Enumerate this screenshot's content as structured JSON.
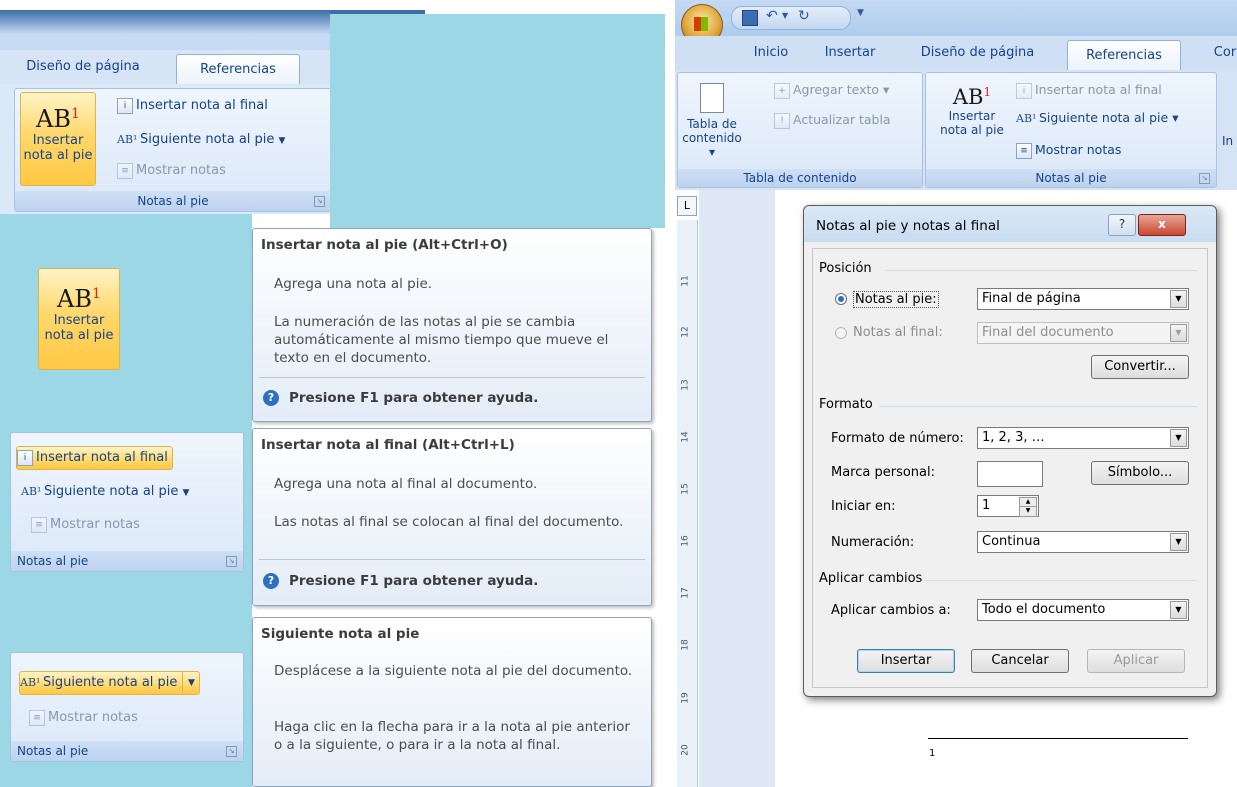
{
  "left": {
    "tabs": [
      "Diseño de página",
      "Referencias"
    ],
    "top_group": {
      "big_button": {
        "line1": "Insertar",
        "line2": "nota al pie"
      },
      "insert_endnote": "Insertar nota al final",
      "next_footnote": "Siguiente nota al pie",
      "show_notes": "Mostrar notas",
      "group_label": "Notas al pie"
    },
    "tooltip1": {
      "title": "Insertar nota al pie (Alt+Ctrl+O)",
      "p1": "Agrega una nota al pie.",
      "p2": "La numeración de las notas al pie se cambia automáticamente al mismo tiempo que mueve el texto en el documento.",
      "help": "Presione F1 para obtener ayuda."
    },
    "big_button2": {
      "line1": "Insertar",
      "line2": "nota al pie"
    },
    "mid_group": {
      "insert_endnote": "Insertar nota al final",
      "next_footnote": "Siguiente nota al pie",
      "show_notes": "Mostrar notas",
      "group_label": "Notas al pie"
    },
    "tooltip2": {
      "title": "Insertar nota al final (Alt+Ctrl+L)",
      "p1": "Agrega una nota al final al documento.",
      "p2": "Las notas al final se colocan al final del documento.",
      "help": "Presione F1 para obtener ayuda."
    },
    "bottom_group": {
      "next_footnote": "Siguiente nota al pie",
      "show_notes": "Mostrar notas",
      "group_label": "Notas al pie"
    },
    "tooltip3": {
      "title": "Siguiente nota al pie",
      "p1": "Desplácese a la siguiente nota al pie del documento.",
      "p2": "Haga clic en la flecha para ir a la nota al pie anterior o a la siguiente, o para ir a la nota al final."
    }
  },
  "right": {
    "tabs": [
      "Inicio",
      "Insertar",
      "Diseño de página",
      "Referencias",
      "Cor"
    ],
    "toc_group": {
      "toc_button_line1": "Tabla de",
      "toc_button_line2": "contenido",
      "add_text": "Agregar texto",
      "update_table": "Actualizar tabla",
      "group_label": "Tabla de contenido"
    },
    "notes_group": {
      "insert_line1": "Insertar",
      "insert_line2": "nota al pie",
      "insert_endnote": "Insertar nota al final",
      "next_footnote": "Siguiente nota al pie",
      "show_notes": "Mostrar notas",
      "group_label": "Notas al pie",
      "cut_label": "In"
    },
    "ruler_numbers": [
      "11",
      "12",
      "13",
      "14",
      "15",
      "16",
      "17",
      "18",
      "19",
      "20"
    ],
    "footnote_number": "1"
  },
  "dialog": {
    "title": "Notas al pie y notas al final",
    "help_button": "?",
    "close_button": "x",
    "position_section": "Posición",
    "footnotes_label": "Notas al pie:",
    "footnotes_value": "Final de página",
    "endnotes_label": "Notas al final:",
    "endnotes_value": "Final del documento",
    "convert_button": "Convertir...",
    "format_section": "Formato",
    "number_format_label": "Formato de número:",
    "number_format_value": "1, 2, 3, …",
    "custom_mark_label": "Marca personal:",
    "custom_mark_value": "",
    "symbol_button": "Símbolo...",
    "start_at_label": "Iniciar en:",
    "start_at_value": "1",
    "numbering_label": "Numeración:",
    "numbering_value": "Continua",
    "apply_section": "Aplicar cambios",
    "apply_to_label": "Aplicar cambios a:",
    "apply_to_value": "Todo el documento",
    "insert_button": "Insertar",
    "cancel_button": "Cancelar",
    "apply_button": "Aplicar"
  }
}
